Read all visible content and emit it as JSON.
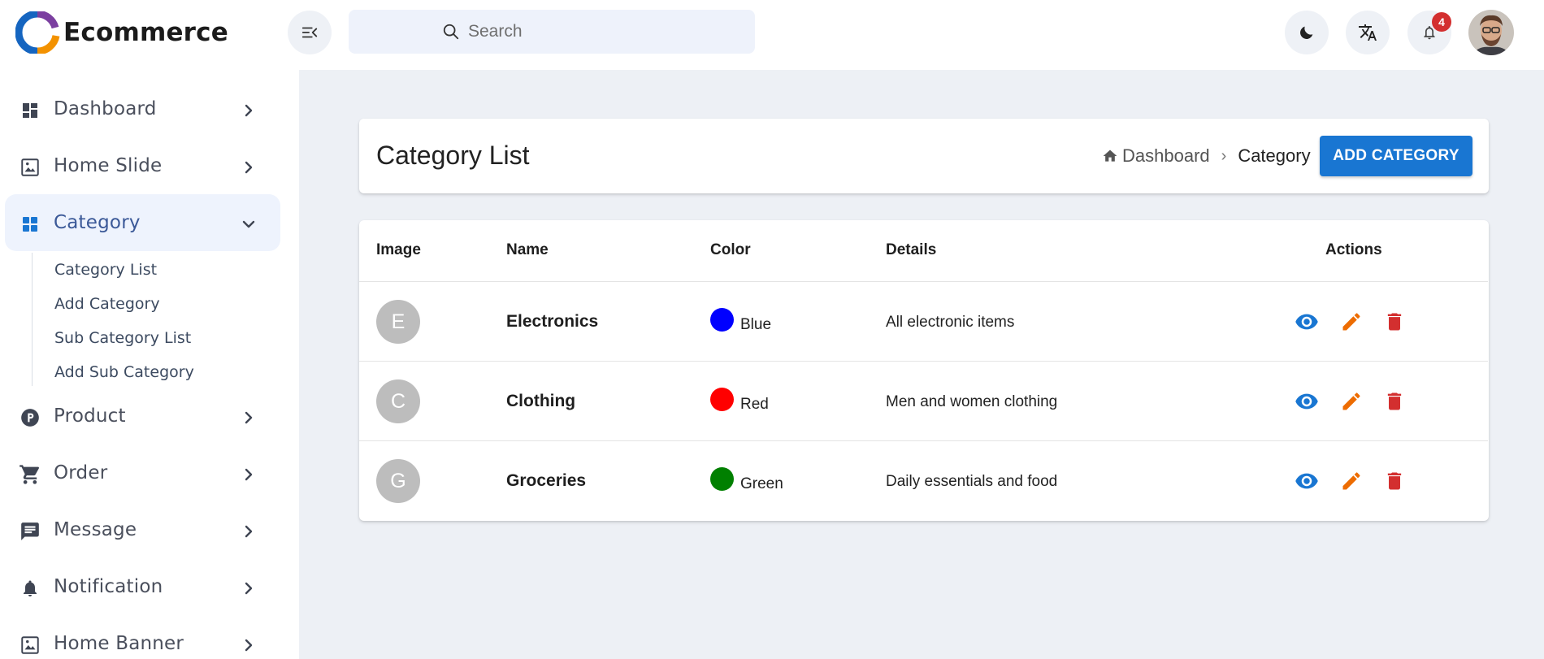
{
  "header": {
    "brand_name": "Ecommerce",
    "search_placeholder": "Search",
    "notification_count": "4",
    "accent_color": "#1976d2"
  },
  "sidebar": {
    "items": [
      {
        "label": "Dashboard",
        "icon": "dashboard-icon"
      },
      {
        "label": "Home Slide",
        "icon": "image-icon"
      },
      {
        "label": "Category",
        "icon": "category-icon",
        "expanded": true
      },
      {
        "label": "Product",
        "icon": "product-icon"
      },
      {
        "label": "Order",
        "icon": "cart-icon"
      },
      {
        "label": "Message",
        "icon": "message-icon"
      },
      {
        "label": "Notification",
        "icon": "bell-icon"
      },
      {
        "label": "Home Banner",
        "icon": "image-icon"
      }
    ],
    "category_sub_items": [
      "Category List",
      "Add Category",
      "Sub Category List",
      "Add Sub Category"
    ]
  },
  "page": {
    "title": "Category List",
    "breadcrumb": [
      "Dashboard",
      "Category"
    ],
    "breadcrumb_separator": "›",
    "add_button_label": "ADD CATEGORY"
  },
  "table": {
    "columns": [
      "Image",
      "Name",
      "Color",
      "Details",
      "Actions"
    ],
    "rows": [
      {
        "initial": "E",
        "name": "Electronics",
        "color_name": "Blue",
        "color_hex": "#0000ff",
        "details": "All electronic items"
      },
      {
        "initial": "C",
        "name": "Clothing",
        "color_name": "Red",
        "color_hex": "#ff0000",
        "details": "Men and women clothing"
      },
      {
        "initial": "G",
        "name": "Groceries",
        "color_name": "Green",
        "color_hex": "#008000",
        "details": "Daily essentials and food"
      }
    ],
    "action_colors": {
      "view": "#1976d2",
      "edit": "#ed6c02",
      "delete": "#d32f2f"
    }
  }
}
